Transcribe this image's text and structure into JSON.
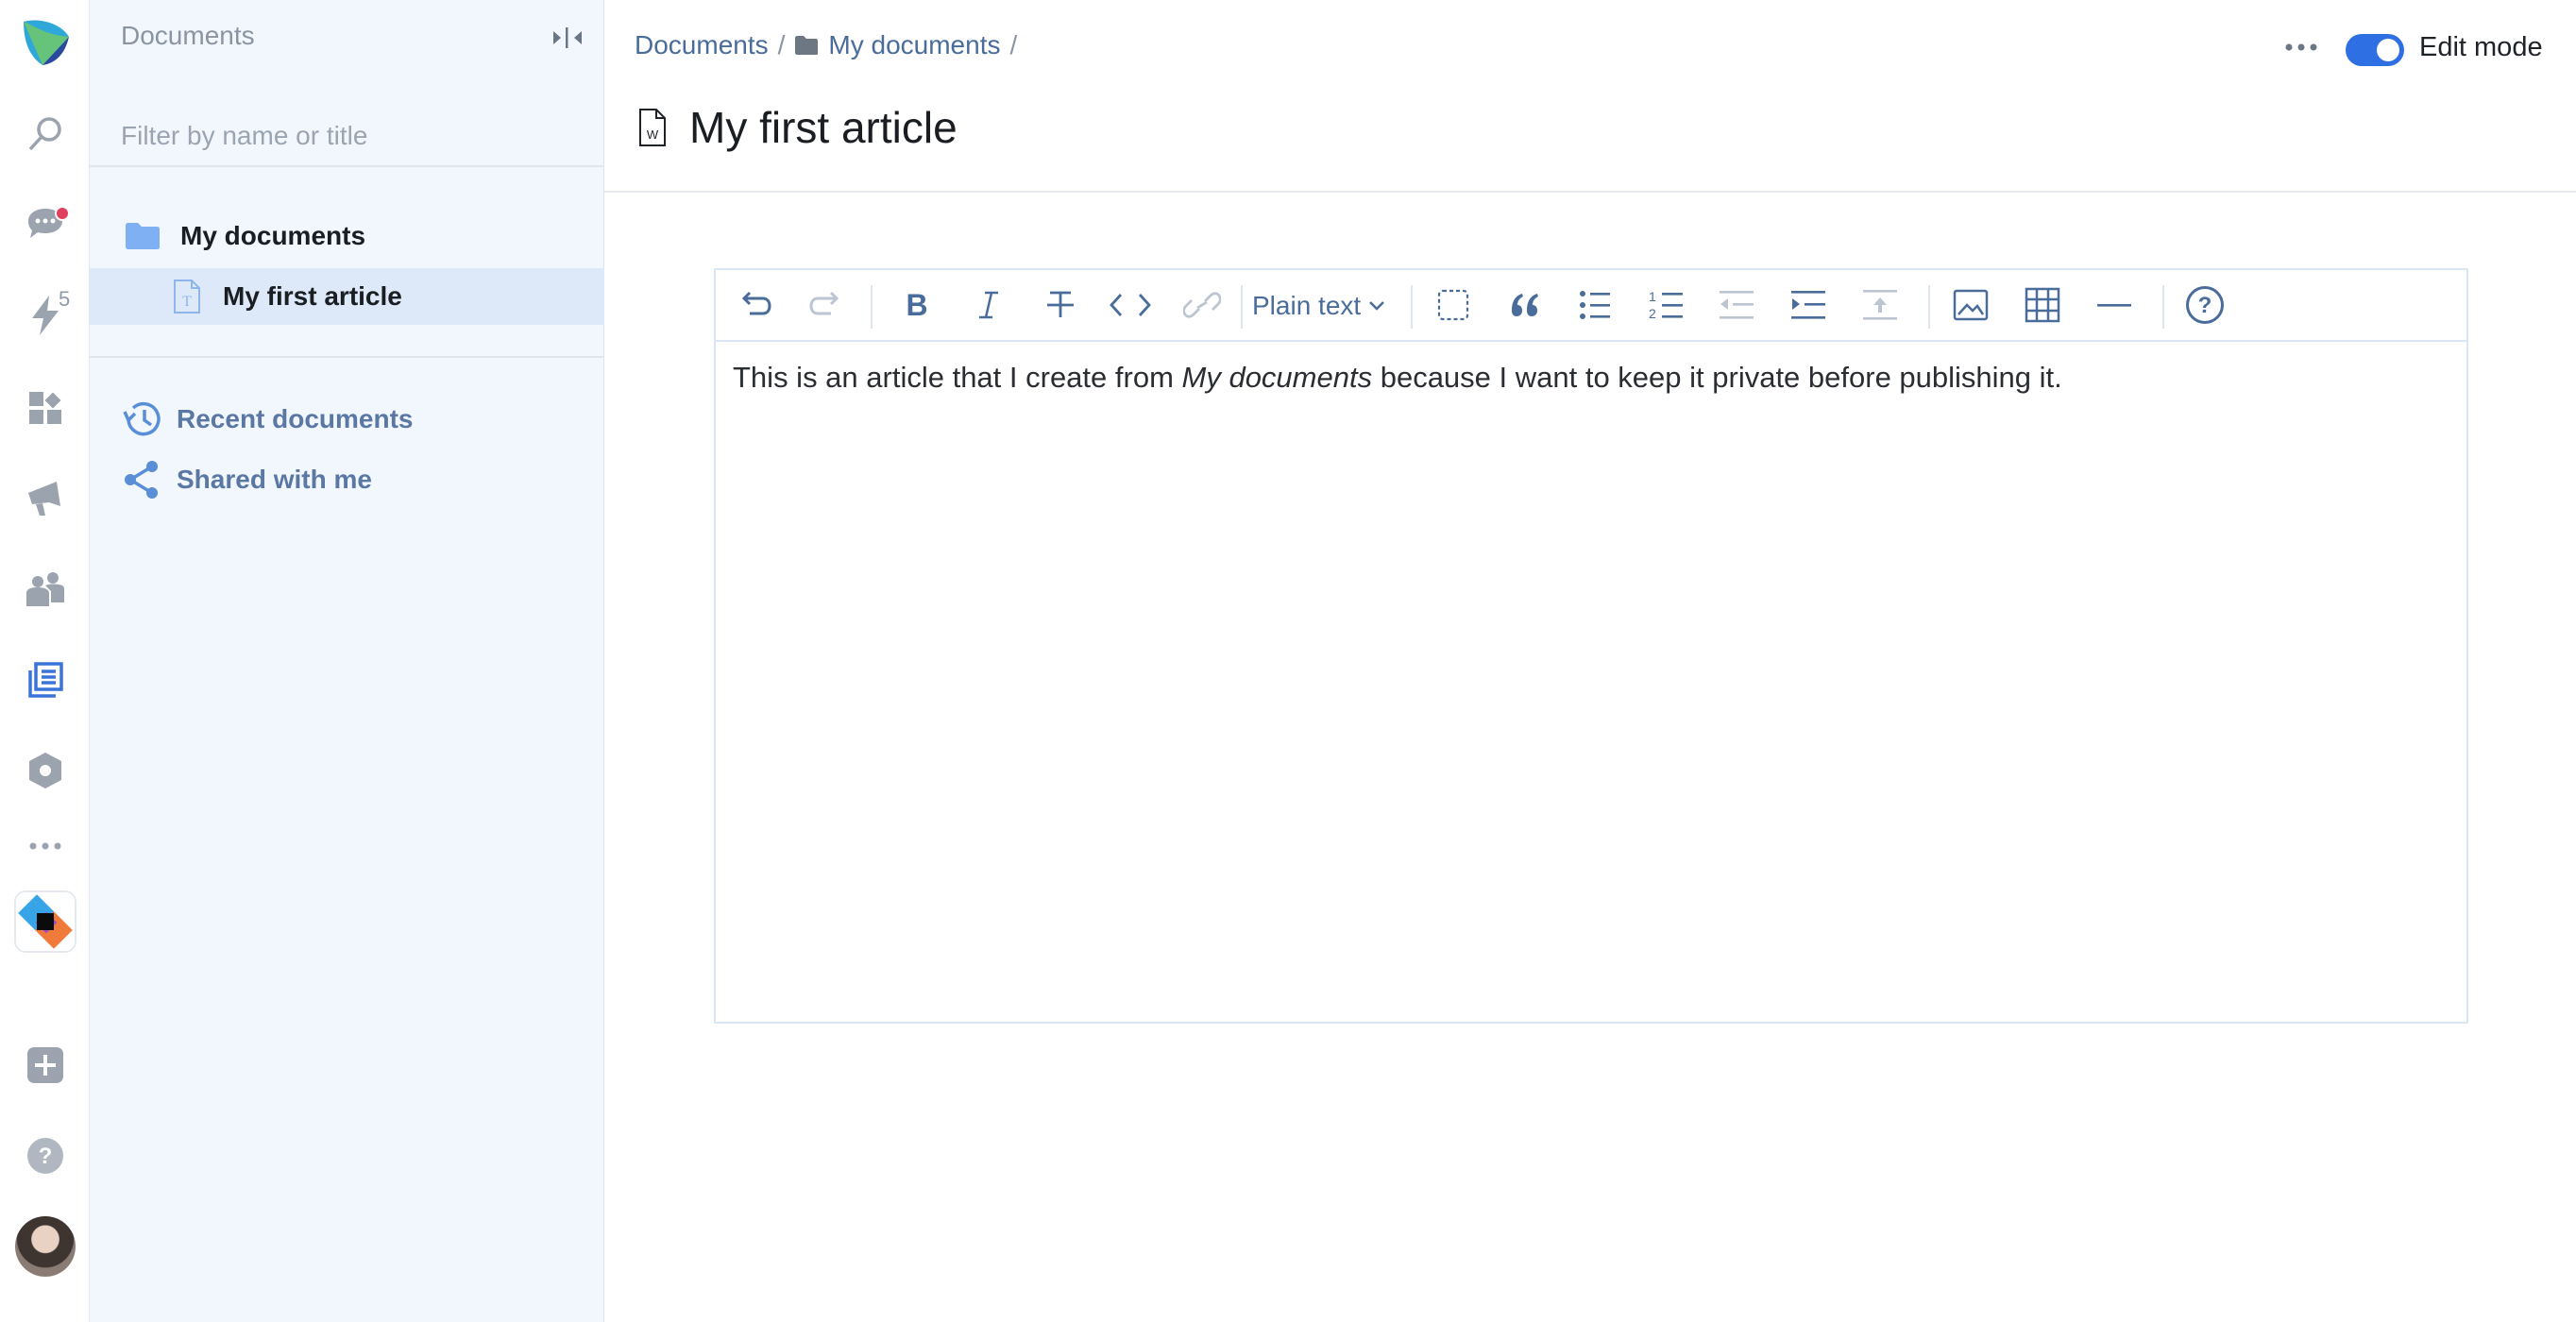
{
  "sidebar": {
    "title": "Documents",
    "filter_placeholder": "Filter by name or title",
    "tree": [
      {
        "label": "My documents",
        "icon": "folder-icon"
      },
      {
        "label": "My first article",
        "icon": "text-document-icon",
        "selected": true
      }
    ],
    "nav": [
      {
        "label": "Recent documents",
        "icon": "history-icon"
      },
      {
        "label": "Shared with me",
        "icon": "share-icon"
      }
    ]
  },
  "rail": {
    "notification_count": "5",
    "items": [
      "logo-icon",
      "search-icon",
      "chat-icon",
      "activity-icon",
      "widgets-icon",
      "announcements-icon",
      "people-icon",
      "documents-icon",
      "settings-icon",
      "more-icon",
      "app-icon",
      "add-icon",
      "help-icon",
      "avatar"
    ]
  },
  "header": {
    "breadcrumb": [
      "Documents",
      "My documents"
    ],
    "edit_mode_label": "Edit mode",
    "edit_mode_on": true,
    "page_title": "My first article"
  },
  "editor": {
    "style_select": "Plain text",
    "toolbar": [
      "undo-icon",
      "redo-icon",
      "bold-icon",
      "italic-icon",
      "strikethrough-icon",
      "code-icon",
      "link-icon",
      "section-icon",
      "blockquote-icon",
      "bulleted-list-icon",
      "numbered-list-icon",
      "outdent-icon",
      "indent-icon",
      "insert-above-icon",
      "image-icon",
      "table-icon",
      "horizontal-line-icon",
      "help-icon"
    ],
    "content_before": "This is an article that I create from ",
    "content_emphasis": "My documents",
    "content_after": " because I want to keep it private before publishing it."
  },
  "colors": {
    "accent": "#2f6fe4",
    "link": "#4a6c9b",
    "sidebar_bg": "#f1f7fd",
    "selected_row": "#dde9f8",
    "notification": "#e2405f"
  }
}
